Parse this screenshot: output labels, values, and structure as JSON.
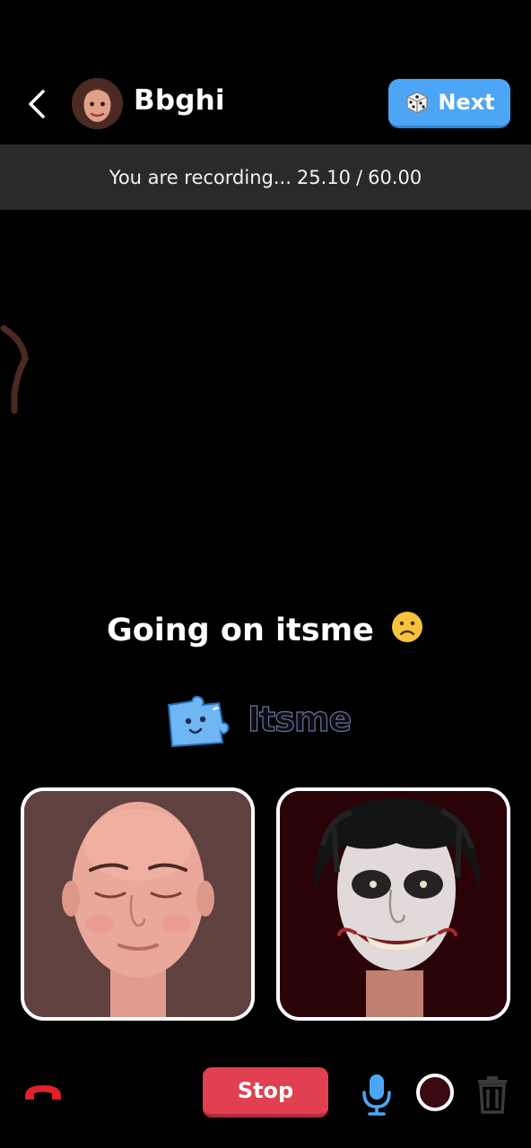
{
  "header": {
    "username": "Bbghi",
    "next_label": "Next",
    "avatar_icon": "user-avatar",
    "back_icon": "chevron-left-icon",
    "dice_icon": "dice-icon"
  },
  "recording": {
    "text": "You are recording...",
    "elapsed": "25.10",
    "separator": "/",
    "total": "60.00"
  },
  "message": {
    "text": "Going on itsme",
    "emoji": "☹"
  },
  "logo": {
    "text": "Itsme"
  },
  "controls": {
    "stop_label": "Stop",
    "hangup_icon": "phone-hangup-icon",
    "mic_icon": "microphone-icon",
    "record_icon": "record-circle-icon",
    "trash_icon": "trash-icon"
  },
  "colors": {
    "next_button": "#4da6f5",
    "stop_button": "#e04050",
    "banner": "#2a2a2b",
    "hangup": "#e0202a",
    "mic": "#4da6f5"
  }
}
